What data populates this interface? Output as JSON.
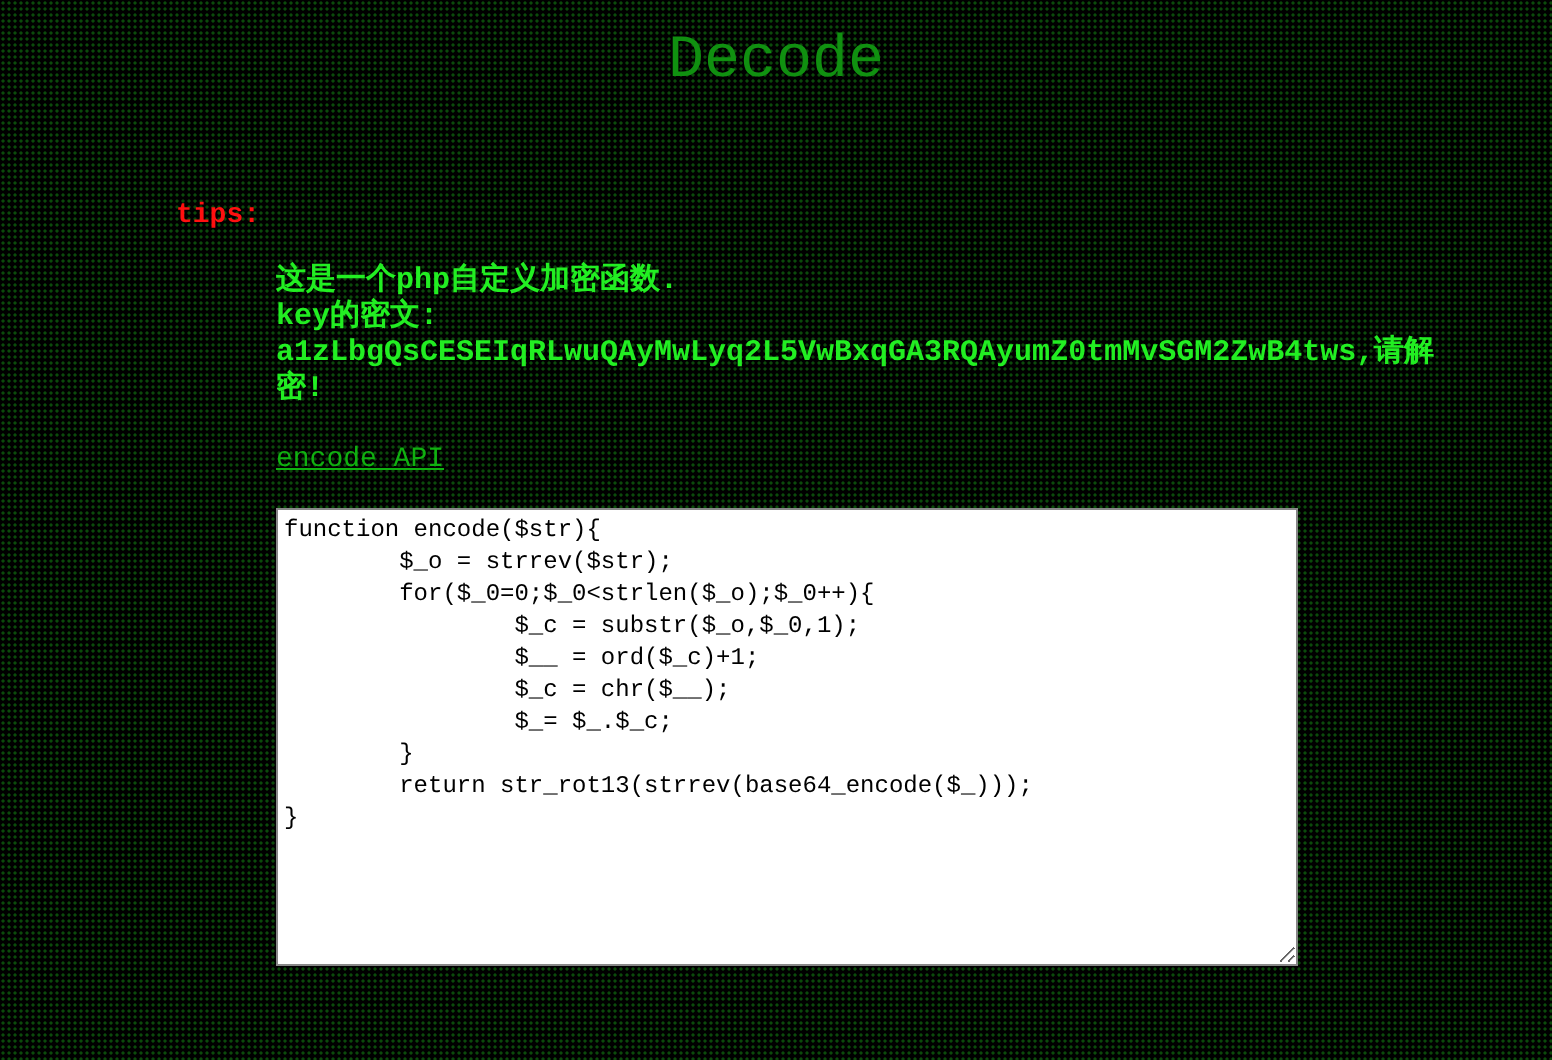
{
  "title": "Decode",
  "tips": {
    "label": "tips:",
    "lines": [
      "这是一个php自定义加密函数.",
      "key的密文:",
      "a1zLbgQsCESEIqRLwuQAyMwLyq2L5VwBxqGA3RQAyumZ0tmMvSGM2ZwB4tws,请解密!"
    ]
  },
  "link": "encode API",
  "code": "function encode($str){\n\t$_o = strrev($str);\n\tfor($_0=0;$_0<strlen($_o);$_0++){\n\t\t$_c = substr($_o,$_0,1);\n\t\t$__ = ord($_c)+1;\n\t\t$_c = chr($__);\n\t\t$_= $_.$_c;\n\t}\n\treturn str_rot13(strrev(base64_encode($_)));\n}"
}
